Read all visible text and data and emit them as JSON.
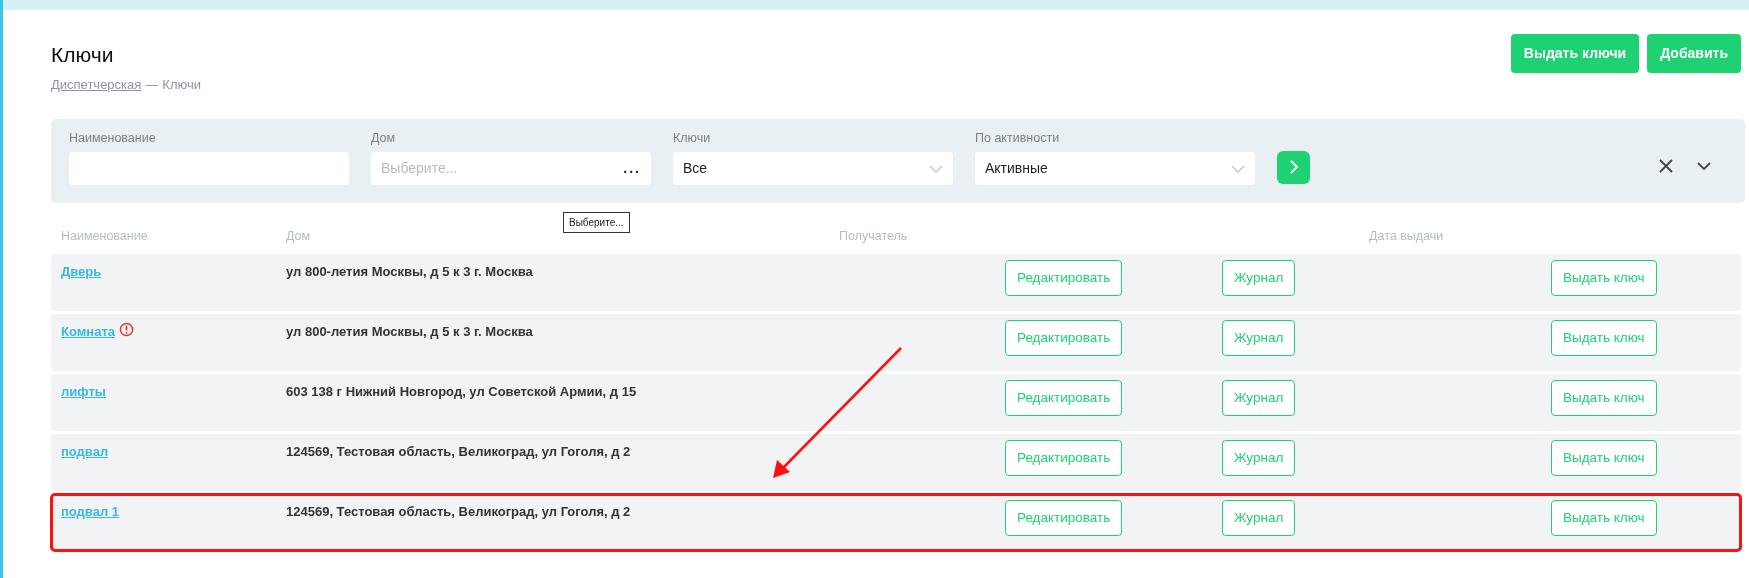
{
  "page": {
    "title": "Ключи",
    "breadcrumb": {
      "link": "Диспетчерская",
      "separator": "—",
      "current": "Ключи"
    }
  },
  "header_buttons": [
    "Выдать ключи",
    "Добавить"
  ],
  "filters": [
    {
      "kind": "text",
      "label": "Наименование"
    },
    {
      "kind": "picker",
      "label": "Дом",
      "placeholder": "Выберите...",
      "button": "...",
      "tooltip": "Выберите..."
    },
    {
      "kind": "select",
      "label": "Ключи",
      "value": "Все"
    },
    {
      "kind": "select",
      "label": "По активности",
      "value": "Активные"
    }
  ],
  "table": {
    "columns": [
      "Наименование",
      "Дом",
      "Получатель",
      "Дата выдачи"
    ],
    "rows": [
      {
        "name": "Дверь",
        "warning": false,
        "house": "ул 800-летия Москвы, д 5 к 3 г. Москва",
        "actions": [
          "Редактировать",
          "Журнал",
          "Выдать ключ"
        ],
        "highlighted": false
      },
      {
        "name": "Комната",
        "warning": true,
        "house": "ул 800-летия Москвы, д 5 к 3 г. Москва",
        "actions": [
          "Редактировать",
          "Журнал",
          "Выдать ключ"
        ],
        "highlighted": false
      },
      {
        "name": "лифты",
        "warning": false,
        "house": "603 138 г Нижний Новгород, ул Советской Армии, д 15",
        "actions": [
          "Редактировать",
          "Журнал",
          "Выдать ключ"
        ],
        "highlighted": false
      },
      {
        "name": "подвал",
        "warning": false,
        "house": "124569, Тестовая область, Великоград, ул Гоголя, д 2",
        "actions": [
          "Редактировать",
          "Журнал",
          "Выдать ключ"
        ],
        "highlighted": false
      },
      {
        "name": "подвал 1",
        "warning": false,
        "house": "124569, Тестовая область, Великоград, ул Гоголя, д 2",
        "actions": [
          "Редактировать",
          "Журнал",
          "Выдать ключ"
        ],
        "highlighted": true
      }
    ]
  }
}
